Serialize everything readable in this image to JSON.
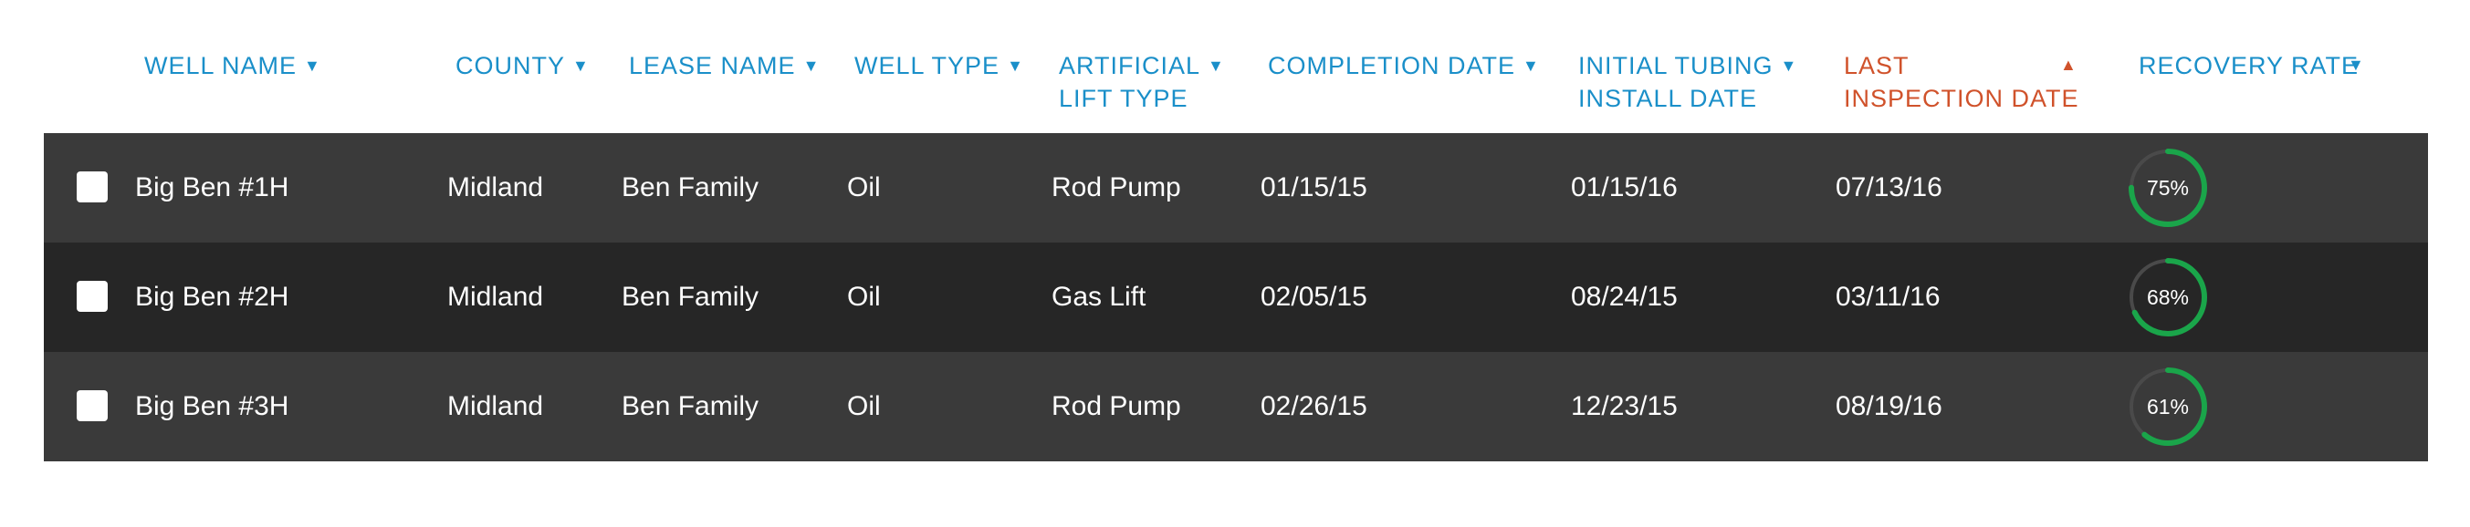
{
  "columns": {
    "well_name": "WELL NAME",
    "county": "COUNTY",
    "lease_name": "LEASE NAME",
    "well_type": "WELL TYPE",
    "artificial_lift_1": "ARTIFICIAL",
    "artificial_lift_2": "LIFT TYPE",
    "completion_date": "COMPLETION DATE",
    "initial_tubing_1": "INITIAL TUBING",
    "initial_tubing_2": "INSTALL DATE",
    "last_inspection_1": "LAST",
    "last_inspection_2": "INSPECTION DATE",
    "recovery_rate": "RECOVERY RATE"
  },
  "sort": {
    "active_column": "last_inspection_date",
    "direction": "ascending"
  },
  "colors": {
    "header_text": "#1a8fc9",
    "active_header_text": "#d0522b",
    "row_dark": "#262626",
    "row_light": "#3a3a3a",
    "gauge_fill": "#1aa54a",
    "gauge_track": "#4a4a4a"
  },
  "rows": [
    {
      "checked": false,
      "well_name": "Big Ben #1H",
      "county": "Midland",
      "lease_name": "Ben Family",
      "well_type": "Oil",
      "lift_type": "Rod Pump",
      "completion_date": "01/15/15",
      "initial_tubing_install_date": "01/15/16",
      "last_inspection_date": "07/13/16",
      "recovery_rate": 0.75,
      "recovery_rate_label": "75%"
    },
    {
      "checked": false,
      "well_name": "Big Ben #2H",
      "county": "Midland",
      "lease_name": "Ben Family",
      "well_type": "Oil",
      "lift_type": "Gas Lift",
      "completion_date": "02/05/15",
      "initial_tubing_install_date": "08/24/15",
      "last_inspection_date": "03/11/16",
      "recovery_rate": 0.68,
      "recovery_rate_label": "68%"
    },
    {
      "checked": false,
      "well_name": "Big Ben #3H",
      "county": "Midland",
      "lease_name": "Ben Family",
      "well_type": "Oil",
      "lift_type": "Rod Pump",
      "completion_date": "02/26/15",
      "initial_tubing_install_date": "12/23/15",
      "last_inspection_date": "08/19/16",
      "recovery_rate": 0.61,
      "recovery_rate_label": "61%"
    }
  ]
}
